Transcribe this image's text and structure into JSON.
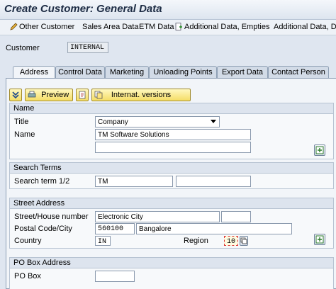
{
  "window": {
    "title": "Create Customer: General Data"
  },
  "appbar": {
    "items": [
      "Other Customer",
      "Sales Area Data",
      "ETM Data",
      "Additional Data, Empties",
      "Additional Data, DSD"
    ]
  },
  "customer": {
    "label": "Customer",
    "value": "INTERNAL"
  },
  "tabs": [
    "Address",
    "Control Data",
    "Marketing",
    "Unloading Points",
    "Export Data",
    "Contact Person"
  ],
  "address_toolbar": {
    "preview_label": "Preview",
    "intl_label": "Internat. versions"
  },
  "name_group": {
    "heading": "Name",
    "title_label": "Title",
    "title_value": "Company",
    "name_label": "Name",
    "name_value": "TM Software Solutions",
    "name2_value": ""
  },
  "search_group": {
    "heading": "Search Terms",
    "term_label": "Search term 1/2",
    "term1_value": "TM",
    "term2_value": ""
  },
  "street_group": {
    "heading": "Street Address",
    "street_label": "Street/House number",
    "street_value": "Electronic City",
    "house_value": "",
    "postal_label": "Postal Code/City",
    "postal_value": "560100",
    "city_value": "Bangalore",
    "country_label": "Country",
    "country_value": "IN",
    "region_label": "Region",
    "region_value": "10"
  },
  "pobox_group": {
    "heading": "PO Box Address",
    "pobox_label": "PO Box",
    "pobox_value": ""
  }
}
